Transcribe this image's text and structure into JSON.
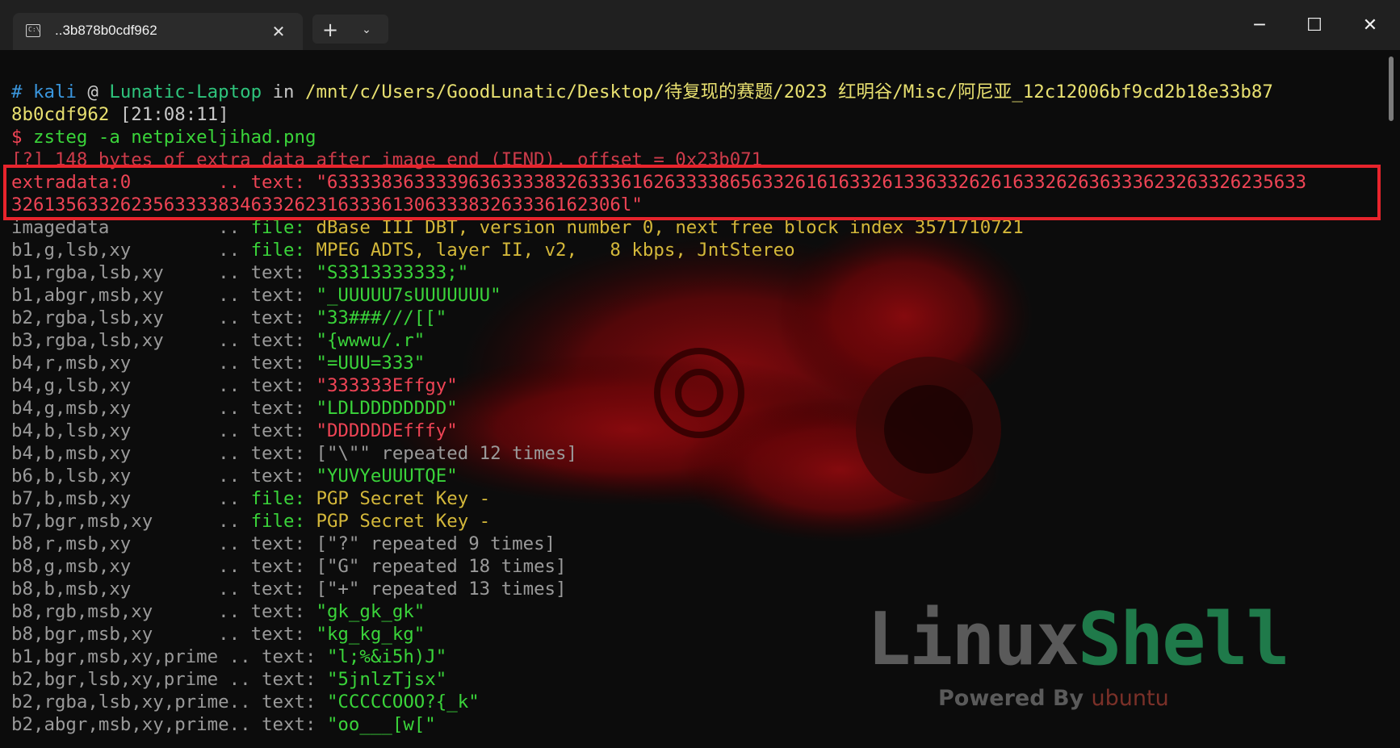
{
  "tab": {
    "title": "..3b878b0cdf962"
  },
  "terminal": {
    "prompt": {
      "hash": "#",
      "user": "kali",
      "at": "@",
      "host": "Lunatic-Laptop",
      "in": "in",
      "path_line1": "/mnt/c/Users/GoodLunatic/Desktop/待复现的赛题/2023 红明谷/Misc/阿尼亚_12c12006bf9cd2b18e33b87",
      "path_line2": "8b0cdf962",
      "time": "[21:08:11]",
      "dollar": "$",
      "command": "zsteg -a netpixeljihad.png"
    },
    "warning": "[?] 148 bytes of extra data after image end (IEND), offset = 0x23b071",
    "extradata": {
      "label": "extradata:0        .. text: ",
      "value_line1": "\"633338363333963633338326333616263333865633261616332613363326261633262636333623263326235633",
      "value_line2": "32613563326235633338346332623163336130633383263336162306l\""
    },
    "rows": [
      {
        "key": "imagedata          .. ",
        "kind": "file: ",
        "value": "dBase III DBT, version number 0, next free block index 3571710721",
        "color": "gold"
      },
      {
        "key": "b1,g,lsb,xy        .. ",
        "kind": "file: ",
        "value": "MPEG ADTS, layer II, v2,   8 kbps, JntStereo",
        "color": "gold"
      },
      {
        "key": "b1,rgba,lsb,xy     .. ",
        "kind": "text: ",
        "value": "\"S3313333333;\"",
        "color": "green"
      },
      {
        "key": "b1,abgr,msb,xy     .. ",
        "kind": "text: ",
        "value": "\"_UUUUU7sUUUUUUU\"",
        "color": "green"
      },
      {
        "key": "b2,rgba,lsb,xy     .. ",
        "kind": "text: ",
        "value": "\"33###///[[\"",
        "color": "green"
      },
      {
        "key": "b3,rgba,lsb,xy     .. ",
        "kind": "text: ",
        "value": "\"{wwwu/.r\"",
        "color": "green"
      },
      {
        "key": "b4,r,msb,xy        .. ",
        "kind": "text: ",
        "value": "\"=UUU=333\"",
        "color": "green"
      },
      {
        "key": "b4,g,lsb,xy        .. ",
        "kind": "text: ",
        "value": "\"333333Effgy\"",
        "color": "red"
      },
      {
        "key": "b4,g,msb,xy        .. ",
        "kind": "text: ",
        "value": "\"LDLDDDDDDDD\"",
        "color": "green"
      },
      {
        "key": "b4,b,lsb,xy        .. ",
        "kind": "text: ",
        "value": "\"DDDDDDEfffy\"",
        "color": "red"
      },
      {
        "key": "b4,b,msb,xy        .. ",
        "kind": "text: ",
        "value": "[\"\\\"\" repeated 12 times]",
        "color": "grey"
      },
      {
        "key": "b6,b,lsb,xy        .. ",
        "kind": "text: ",
        "value": "\"YUVYeUUUTQE\"",
        "color": "green"
      },
      {
        "key": "b7,b,msb,xy        .. ",
        "kind": "file: ",
        "value": "PGP Secret Key -",
        "color": "gold"
      },
      {
        "key": "b7,bgr,msb,xy      .. ",
        "kind": "file: ",
        "value": "PGP Secret Key -",
        "color": "gold"
      },
      {
        "key": "b8,r,msb,xy        .. ",
        "kind": "text: ",
        "value": "[\"?\" repeated 9 times]",
        "color": "grey"
      },
      {
        "key": "b8,g,msb,xy        .. ",
        "kind": "text: ",
        "value": "[\"G\" repeated 18 times]",
        "color": "grey"
      },
      {
        "key": "b8,b,msb,xy        .. ",
        "kind": "text: ",
        "value": "[\"+\" repeated 13 times]",
        "color": "grey"
      },
      {
        "key": "b8,rgb,msb,xy      .. ",
        "kind": "text: ",
        "value": "\"gk_gk_gk\"",
        "color": "green"
      },
      {
        "key": "b8,bgr,msb,xy      .. ",
        "kind": "text: ",
        "value": "\"kg_kg_kg\"",
        "color": "green"
      },
      {
        "key": "b1,bgr,msb,xy,prime .. ",
        "kind": "text: ",
        "value": "\"l;%&i5h)J\"",
        "color": "green"
      },
      {
        "key": "b2,bgr,lsb,xy,prime .. ",
        "kind": "text: ",
        "value": "\"5jnlzTjsx\"",
        "color": "green"
      },
      {
        "key": "b2,rgba,lsb,xy,prime.. ",
        "kind": "text: ",
        "value": "\"CCCCCOOO?{_k\"",
        "color": "green"
      },
      {
        "key": "b2,abgr,msb,xy,prime.. ",
        "kind": "text: ",
        "value": "\"oo___[w[\"",
        "color": "green"
      }
    ]
  },
  "branding": {
    "logo_part1": "Linux",
    "logo_part2": "Shell",
    "powered": "Powered By ",
    "powered_brand": "ubuntu"
  },
  "colors": {
    "highlight_border": "#e8242c",
    "text_green": "#3ad43a",
    "text_red": "#ef4455",
    "text_gold": "#d4b83a"
  }
}
